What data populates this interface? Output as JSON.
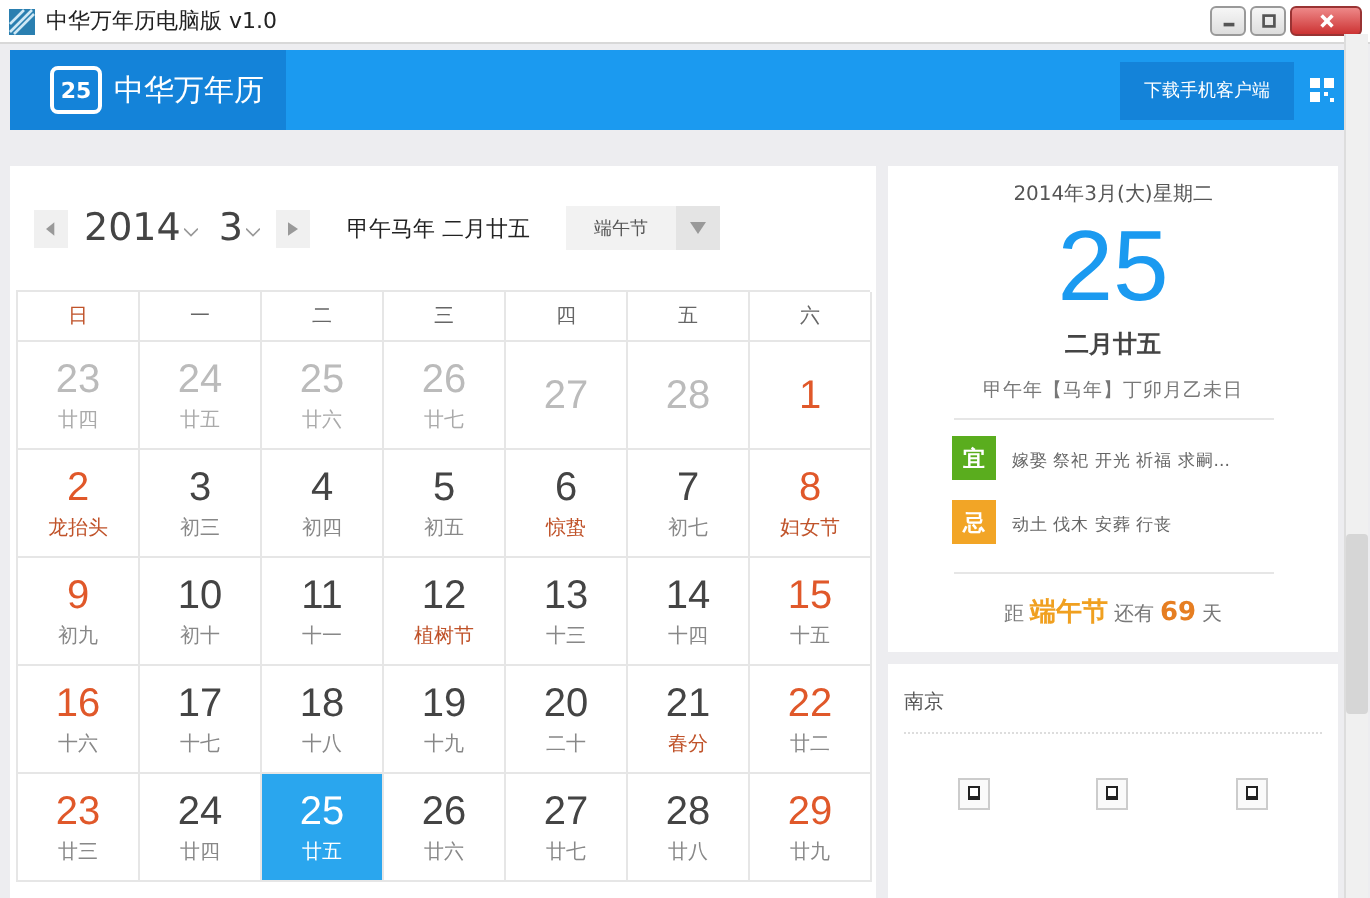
{
  "window": {
    "title": "中华万年历电脑版 v1.0"
  },
  "header": {
    "logo_badge": "25",
    "app_name": "中华万年历",
    "download_button": "下载手机客户端"
  },
  "toolbar": {
    "year": "2014",
    "month": "3",
    "lunar_date": "甲午马年 二月廿五",
    "festival_select": "端午节"
  },
  "weekdays": [
    "日",
    "一",
    "二",
    "三",
    "四",
    "五",
    "六"
  ],
  "weeks": [
    [
      {
        "day": "23",
        "lunar": "廿四",
        "muted": true,
        "selected": false
      },
      {
        "day": "24",
        "lunar": "廿五",
        "muted": true,
        "selected": false
      },
      {
        "day": "25",
        "lunar": "廿六",
        "muted": true,
        "selected": false
      },
      {
        "day": "26",
        "lunar": "廿七",
        "muted": true,
        "selected": false
      },
      {
        "day": "27",
        "muted": true,
        "selected": false
      },
      {
        "day": "28",
        "muted": true,
        "selected": false
      },
      {
        "day": "1",
        "muted": false,
        "selected": false
      }
    ],
    [
      {
        "day": "2",
        "lunar": "龙抬头",
        "muted": false,
        "holiday": true,
        "selected": false
      },
      {
        "day": "3",
        "lunar": "初三",
        "muted": false,
        "holiday": false,
        "selected": false
      },
      {
        "day": "4",
        "lunar": "初四",
        "muted": false,
        "holiday": false,
        "selected": false
      },
      {
        "day": "5",
        "lunar": "初五",
        "muted": false,
        "holiday": false,
        "selected": false
      },
      {
        "day": "6",
        "lunar": "惊蛰",
        "muted": false,
        "holiday": true,
        "selected": false
      },
      {
        "day": "7",
        "lunar": "初七",
        "muted": false,
        "holiday": false,
        "selected": false
      },
      {
        "day": "8",
        "lunar": "妇女节",
        "muted": false,
        "holiday": true,
        "selected": false
      }
    ],
    [
      {
        "day": "9",
        "lunar": "初九",
        "muted": false,
        "holiday": false,
        "selected": false
      },
      {
        "day": "10",
        "lunar": "初十",
        "muted": false,
        "holiday": false,
        "selected": false
      },
      {
        "day": "11",
        "lunar": "十一",
        "muted": false,
        "holiday": false,
        "selected": false
      },
      {
        "day": "12",
        "lunar": "植树节",
        "muted": false,
        "holiday": true,
        "selected": false
      },
      {
        "day": "13",
        "lunar": "十三",
        "muted": false,
        "holiday": false,
        "selected": false
      },
      {
        "day": "14",
        "lunar": "十四",
        "muted": false,
        "holiday": false,
        "selected": false
      },
      {
        "day": "15",
        "lunar": "十五",
        "muted": false,
        "holiday": false,
        "selected": false
      }
    ],
    [
      {
        "day": "16",
        "lunar": "十六",
        "muted": false,
        "holiday": false,
        "selected": false
      },
      {
        "day": "17",
        "lunar": "十七",
        "muted": false,
        "holiday": false,
        "selected": false
      },
      {
        "day": "18",
        "lunar": "十八",
        "muted": false,
        "holiday": false,
        "selected": false
      },
      {
        "day": "19",
        "lunar": "十九",
        "muted": false,
        "holiday": false,
        "selected": false
      },
      {
        "day": "20",
        "lunar": "二十",
        "muted": false,
        "holiday": false,
        "selected": false
      },
      {
        "day": "21",
        "lunar": "春分",
        "muted": false,
        "holiday": true,
        "selected": false
      },
      {
        "day": "22",
        "lunar": "廿二",
        "muted": false,
        "holiday": false,
        "selected": false
      }
    ],
    [
      {
        "day": "23",
        "lunar": "廿三",
        "muted": false,
        "holiday": false,
        "selected": false
      },
      {
        "day": "24",
        "lunar": "廿四",
        "muted": false,
        "holiday": false,
        "selected": false
      },
      {
        "day": "25",
        "lunar": "廿五",
        "muted": false,
        "selected": true
      },
      {
        "day": "26",
        "lunar": "廿六",
        "muted": false,
        "holiday": false,
        "selected": false
      },
      {
        "day": "27",
        "lunar": "廿七",
        "muted": false,
        "holiday": false,
        "selected": false
      },
      {
        "day": "28",
        "lunar": "廿八",
        "muted": false,
        "holiday": false,
        "selected": false
      },
      {
        "day": "29",
        "lunar": "廿九",
        "muted": false,
        "holiday": false,
        "selected": false
      }
    ]
  ],
  "detail": {
    "date_line": "2014年3月(大)星期二",
    "big_day": "25",
    "lunar_day": "二月廿五",
    "ganzhi": "甲午年【马年】丁卯月乙未日",
    "advice": [
      {
        "badge": "宜",
        "color": "#5aad1e",
        "text": "嫁娶 祭祀 开光 祈福 求嗣..."
      },
      {
        "badge": "忌",
        "color": "#f2a526",
        "text": "动土 伐木 安葬 行丧"
      }
    ],
    "countdown": {
      "prefix": "距",
      "festival": "端午节",
      "middle": "还有",
      "days": "69",
      "suffix": "天"
    }
  },
  "weather": {
    "city": "南京"
  }
}
